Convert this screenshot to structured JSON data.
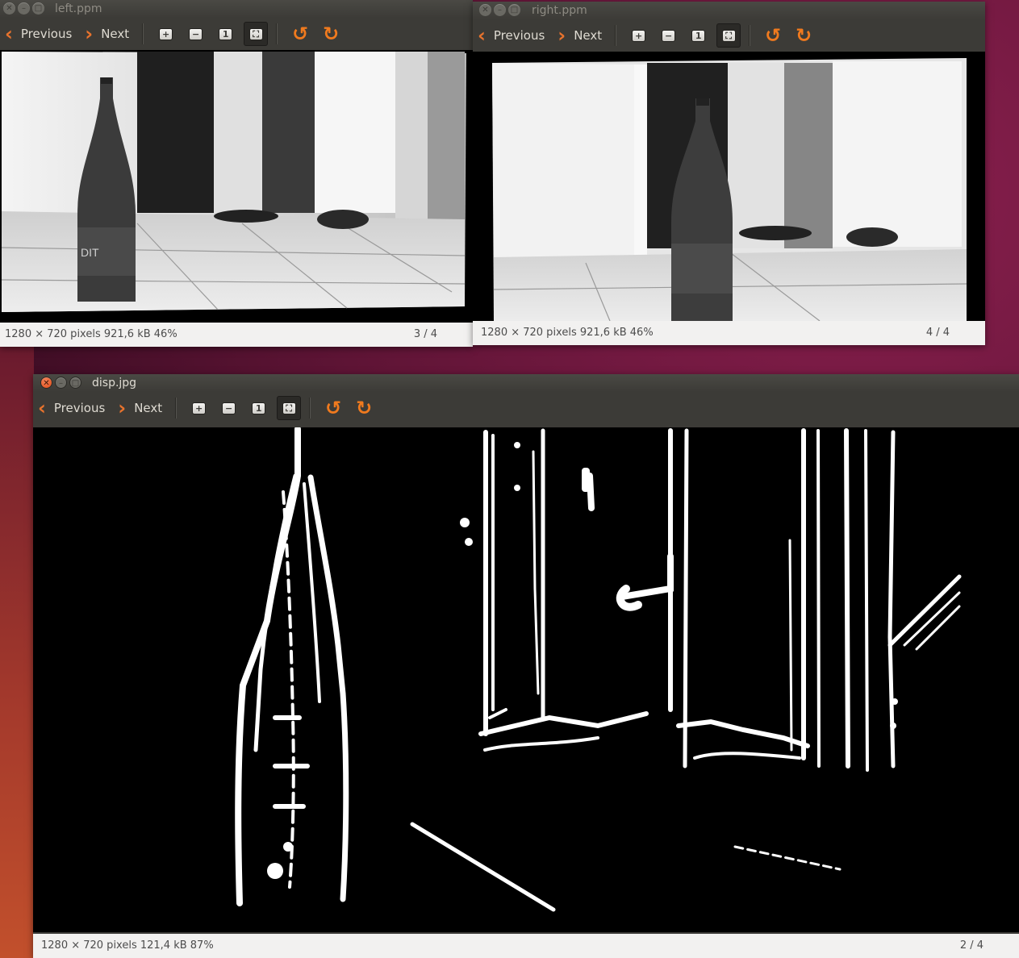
{
  "toolbar": {
    "previous_label": "Previous",
    "next_label": "Next",
    "icons": [
      "zoom-in-icon",
      "zoom-out-icon",
      "zoom-normal-icon",
      "zoom-fit-icon",
      "rotate-left-icon",
      "rotate-right-icon"
    ]
  },
  "windows": {
    "left": {
      "title": "left.ppm",
      "status_info": "1280 × 720 pixels  921,6 kB   46%",
      "page": "3 / 4"
    },
    "right": {
      "title": "right.ppm",
      "status_info": "1280 × 720 pixels  921,6 kB   46%",
      "page": "4 / 4"
    },
    "disp": {
      "title": "disp.jpg",
      "status_info": "1280 × 720 pixels  121,4 kB   87%",
      "page": "2 / 4"
    }
  },
  "bottle_label_text": "DIT",
  "colors": {
    "accent_orange": "#e8732d",
    "titlebar": "#3c3b37",
    "statusbar": "#f2f1f0",
    "close_button": "#df4a16"
  }
}
